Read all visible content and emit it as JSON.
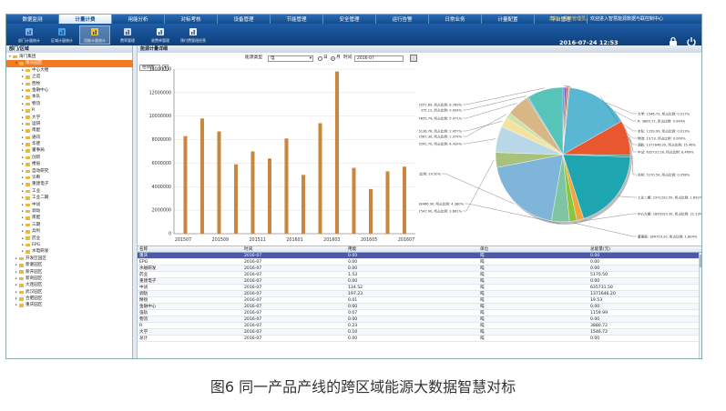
{
  "nav": {
    "tabs": [
      "数据监测",
      "计量计费",
      "用能分析",
      "对标考核",
      "设备管理",
      "节能管理",
      "安全管理",
      "运行告警",
      "日常业务",
      "计量配置",
      "平台管理"
    ],
    "active_index": 1,
    "welcome_prefix": "您好，",
    "welcome_user": "系统管理员",
    "welcome_suffix": "，欢迎进入智慧能源数据与联控制中心"
  },
  "toolbar": {
    "items": [
      "部门计量统计",
      "区域计量统计",
      "用能计量统计",
      "费率管理",
      "收费单管理",
      "预付费管理经营"
    ],
    "active_index": 2,
    "date": "2016-07-24 12:53"
  },
  "sidebar": {
    "header": "部门/区域",
    "items": [
      {
        "label": "海门集团",
        "level": 0,
        "expanded": true,
        "selected": false
      },
      {
        "label": "南乐园区",
        "level": 1,
        "expanded": true,
        "selected": true
      },
      {
        "label": "中心大楼",
        "level": 2,
        "selected": false
      },
      {
        "label": "之谊",
        "level": 2,
        "selected": false
      },
      {
        "label": "西牧",
        "level": 2,
        "selected": false
      },
      {
        "label": "金融中心",
        "level": 2,
        "selected": false
      },
      {
        "label": "本队",
        "level": 2,
        "selected": false
      },
      {
        "label": "物流",
        "level": 2,
        "selected": false
      },
      {
        "label": "R",
        "level": 2,
        "selected": false
      },
      {
        "label": "大学",
        "level": 2,
        "selected": false
      },
      {
        "label": "运研",
        "level": 2,
        "selected": false
      },
      {
        "label": "南配",
        "level": 2,
        "selected": false
      },
      {
        "label": "通讯",
        "level": 2,
        "selected": false
      },
      {
        "label": "华使",
        "level": 2,
        "selected": false
      },
      {
        "label": "董事局",
        "level": 2,
        "selected": false
      },
      {
        "label": "创新",
        "level": 2,
        "selected": false
      },
      {
        "label": "楼层",
        "level": 2,
        "selected": false
      },
      {
        "label": "自动研究",
        "level": 2,
        "selected": false
      },
      {
        "label": "诊断",
        "level": 2,
        "selected": false
      },
      {
        "label": "重建电子",
        "level": 2,
        "selected": false
      },
      {
        "label": "工业",
        "level": 2,
        "selected": false
      },
      {
        "label": "工业二期",
        "level": 2,
        "selected": false
      },
      {
        "label": "中试",
        "level": 2,
        "selected": false
      },
      {
        "label": "调动",
        "level": 2,
        "selected": false
      },
      {
        "label": "南配",
        "level": 2,
        "selected": false
      },
      {
        "label": "三期",
        "level": 2,
        "selected": false
      },
      {
        "label": "兵利",
        "level": 2,
        "selected": false
      },
      {
        "label": "药业",
        "level": 2,
        "selected": false
      },
      {
        "label": "EPG",
        "level": 2,
        "selected": false
      },
      {
        "label": "水电研发",
        "level": 2,
        "selected": false
      },
      {
        "label": "开发区园区",
        "level": 1,
        "selected": false
      },
      {
        "label": "新厦园区",
        "level": 1,
        "selected": false
      },
      {
        "label": "新开园区",
        "level": 1,
        "selected": false
      },
      {
        "label": "新商园区",
        "level": 1,
        "selected": false
      },
      {
        "label": "大连园区",
        "level": 1,
        "selected": false
      },
      {
        "label": "武汉园区",
        "level": 1,
        "selected": false
      },
      {
        "label": "合肥园区",
        "level": 1,
        "selected": false
      },
      {
        "label": "重庆园区",
        "level": 1,
        "selected": false
      }
    ]
  },
  "main": {
    "header": "能源计量详细",
    "filter_label": "能源类型",
    "filter_value": "电",
    "radio_day": "日",
    "radio_month": "月",
    "time_label": "时间",
    "time_value": "2016-07",
    "chart_mode": "柱状图"
  },
  "chart_data": [
    {
      "type": "bar",
      "categories": [
        "201507",
        "201508",
        "201509",
        "201510",
        "201511",
        "201512",
        "201601",
        "201602",
        "201603",
        "201604",
        "201605",
        "201606",
        "201607"
      ],
      "values": [
        8300000,
        9800000,
        8700000,
        5900000,
        7000000,
        6400000,
        8100000,
        5000000,
        9400000,
        13800000,
        5600000,
        3800000,
        5300000,
        5700000
      ],
      "ylim": [
        0,
        14000000
      ],
      "yticks": [
        0,
        2000000,
        4000000,
        6000000,
        8000000,
        10000000,
        12000000,
        14000000
      ],
      "xticklabels": [
        "201507",
        "201509",
        "201511",
        "201601",
        "201603",
        "201605",
        "201607"
      ],
      "color": "#c8863e",
      "grid": true
    },
    {
      "type": "pie",
      "slices": [
        {
          "label": "大学: 1546.72, 所占比例: 0.017%",
          "value": 0.4,
          "color": "#4a6fb5"
        },
        {
          "label": "R: 3880.72, 所占比例: 0.044%",
          "value": 0.4,
          "color": "#7f4aa8"
        },
        {
          "label": "本队: 1159.99, 所占比例: 0.013%",
          "value": 0.4,
          "color": "#a84a4a"
        },
        {
          "label": "物流: 19.53, 所占比例: 0.000%",
          "value": 0.4,
          "color": "#c9a06a"
        },
        {
          "label": "调轨: 1371646.20, 所占比例: 15.46%",
          "value": 15.46,
          "color": "#5ab7d3"
        },
        {
          "label": "中试: 635731.50, 所占比例: 8.469%",
          "value": 8.47,
          "color": "#e8572f"
        },
        {
          "label": "兵利: 5170.50, 所占比例: 0.058%",
          "value": 0.5,
          "color": "#3f8f6f"
        },
        {
          "label": "工业二期: 1971202.50, 所占比例: 1.692%",
          "value": 19.8,
          "color": "#1ea6b0"
        },
        {
          "label": "中心大楼: 1895293.30, 所占比例: 22.13%",
          "value": 1.7,
          "color": "#f0a63a"
        },
        {
          "label": "董事局: 184729.20, 所占比例: 1.804%",
          "value": 1.8,
          "color": "#8cc43f"
        },
        {
          "label": "开封: 388466.90, 所占比例: 4.380%",
          "value": 4.38,
          "color": "#7fc4a3"
        },
        {
          "label": "工业: 1732018.40, 所占比例: 19.50%",
          "value": 19.5,
          "color": "#7fb5d8"
        },
        {
          "label": "远程: 322547.90, 所占比例: 3.661%",
          "value": 3.66,
          "color": "#a8c27c"
        },
        {
          "label": "业绩: 583541.70, 所占比例: 6.439%",
          "value": 6.44,
          "color": "#b8d8e8"
        },
        {
          "label": "平西: 216136.76, 所占比例: 2.457%",
          "value": 2.46,
          "color": "#f4e3a0"
        },
        {
          "label": "董事局: 122567.30, 所占比例: 1.379%",
          "value": 1.38,
          "color": "#cfe3a6"
        },
        {
          "label": "通讯: 484855.74, 所占比例: 5.471%",
          "value": 5.47,
          "color": "#d8b685"
        },
        {
          "label": "航配: 375.12, 所占比例: 0.004%",
          "value": 0.4,
          "color": "#8db5c8"
        },
        {
          "label": "强务: 695557.89, 所占比例: 8.789%",
          "value": 8.79,
          "color": "#56c4b8"
        }
      ],
      "legend": "callouts"
    }
  ],
  "table": {
    "headers": [
      "名称",
      "时间",
      "用能",
      "单位",
      "总能量(元)"
    ],
    "rows": [
      [
        "重庆",
        "2016-07",
        "0.00",
        "吨",
        "0.00"
      ],
      [
        "EPG",
        "2016-07",
        "0.00",
        "吨",
        "0.00"
      ],
      [
        "水磁研发",
        "2016-07",
        "0.00",
        "吨",
        "0.00"
      ],
      [
        "药业",
        "2016-07",
        "1.53",
        "吨",
        "5170.50"
      ],
      [
        "重建电子",
        "2016-07",
        "0.00",
        "吨",
        "0.00"
      ],
      [
        "中试",
        "2016-07",
        "134.52",
        "吨",
        "635731.50"
      ],
      [
        "调轨",
        "2016-07",
        "197.23",
        "吨",
        "1371646.20"
      ],
      [
        "精锐",
        "2016-07",
        "0.01",
        "吨",
        "19.53"
      ],
      [
        "金融中心",
        "2016-07",
        "0.00",
        "吨",
        "0.00"
      ],
      [
        "强轨",
        "2016-07",
        "0.07",
        "吨",
        "1159.99"
      ],
      [
        "物流",
        "2016-07",
        "0.00",
        "吨",
        "0.00"
      ],
      [
        "R",
        "2016-07",
        "0.23",
        "吨",
        "3880.72"
      ],
      [
        "大学",
        "2016-07",
        "0.10",
        "吨",
        "1546.72"
      ],
      [
        "总计",
        "2016-07",
        "0.00",
        "吨",
        "0.00"
      ]
    ],
    "selected_index": 0
  },
  "caption": "图6 同一产品产线的跨区域能源大数据智慧对标",
  "colors": {
    "nav": "#1f5da7",
    "selected": "#f47920",
    "row_selected": "#4b5aa8",
    "bar": "#c8863e"
  }
}
